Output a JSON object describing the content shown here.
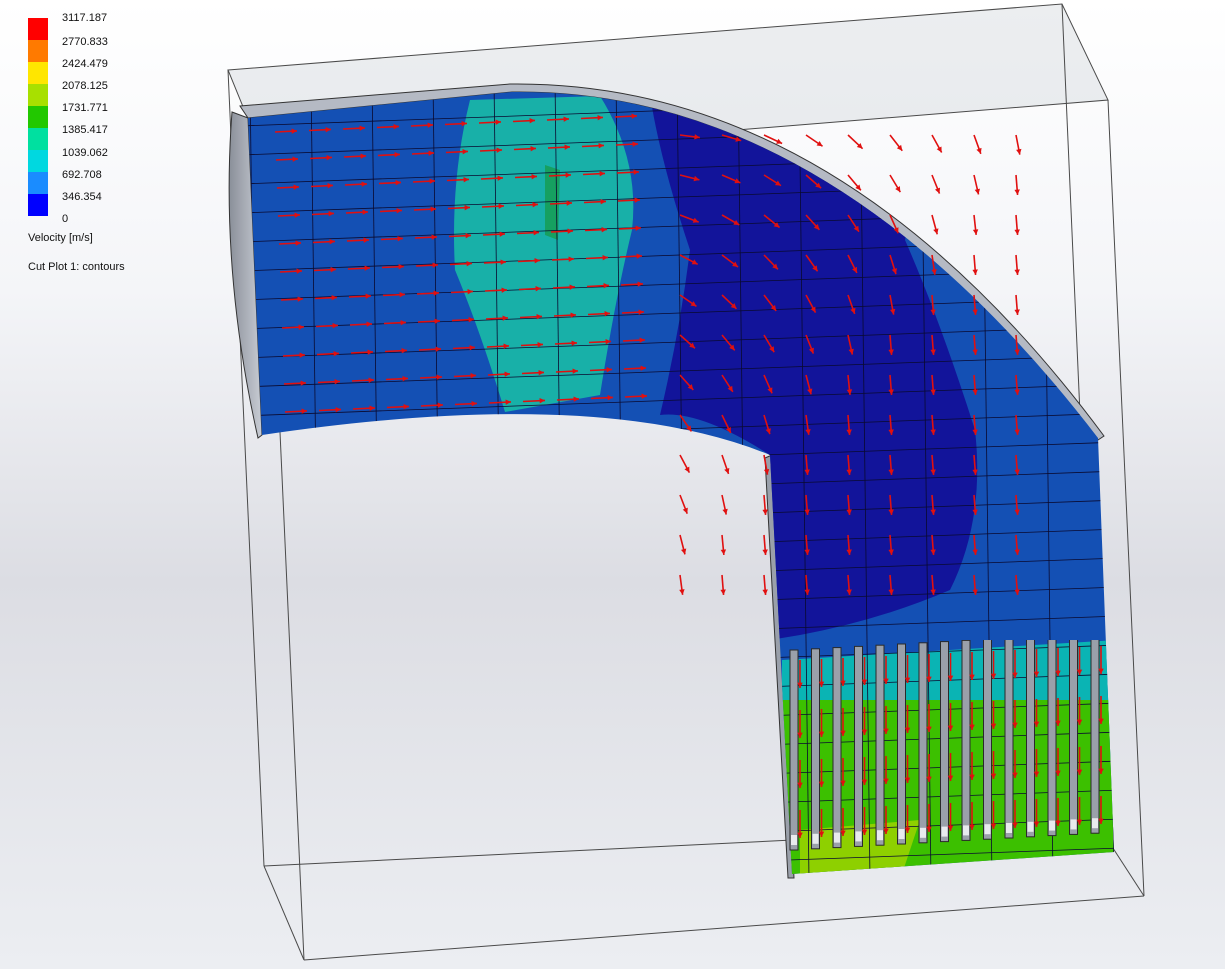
{
  "legend": {
    "ticks": [
      "3117.187",
      "2770.833",
      "2424.479",
      "2078.125",
      "1731.771",
      "1385.417",
      "1039.062",
      "692.708",
      "346.354",
      "0"
    ],
    "colors": [
      "#ff0000",
      "#ff7a00",
      "#ffe600",
      "#a8e000",
      "#22c800",
      "#00e0a0",
      "#00d8e0",
      "#1a8cff",
      "#0000ff"
    ],
    "quantity": "Velocity [m/s]",
    "plot_name": "Cut Plot 1: contours"
  },
  "plot": {
    "zone_colors": {
      "outer_blue": "#1450b4",
      "mid_teal": "#18b0a8",
      "core_green": "#16a060",
      "dark_blue": "#12149a",
      "fin_green": "#3cc000",
      "fin_teal": "#0ab4b4"
    },
    "vector_color": "#e01010"
  }
}
